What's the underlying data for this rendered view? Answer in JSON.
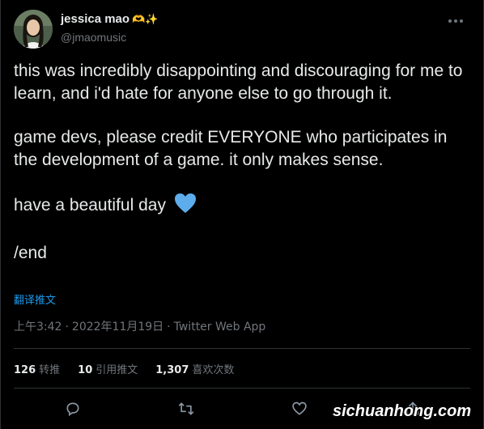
{
  "author": {
    "display_name": "jessica mao",
    "emoji": "🫶✨",
    "handle": "@jmaomusic"
  },
  "tweet": {
    "paragraph_1": "this was incredibly disappointing and discouraging for me to learn, and i'd hate for anyone else to go through it.",
    "paragraph_2": "game devs, please credit EVERYONE who participates in the development of a game. it only makes sense.",
    "paragraph_3": "have a beautiful day",
    "paragraph_3_emoji": "blue-heart-icon",
    "paragraph_4": "/end"
  },
  "translate_label": "翻译推文",
  "meta": {
    "time": "上午3:42",
    "date": "2022年11月19日",
    "source": "Twitter Web App",
    "separator": "·"
  },
  "stats": {
    "retweets_count": "126",
    "retweets_label": "转推",
    "quotes_count": "10",
    "quotes_label": "引用推文",
    "likes_count": "1,307",
    "likes_label": "喜欢次数"
  },
  "watermark": "sichuanhong.com",
  "colors": {
    "background": "#000000",
    "text": "#e7e9ea",
    "secondary": "#71767b",
    "accent": "#1d9bf0",
    "heart": "#5dadec"
  }
}
